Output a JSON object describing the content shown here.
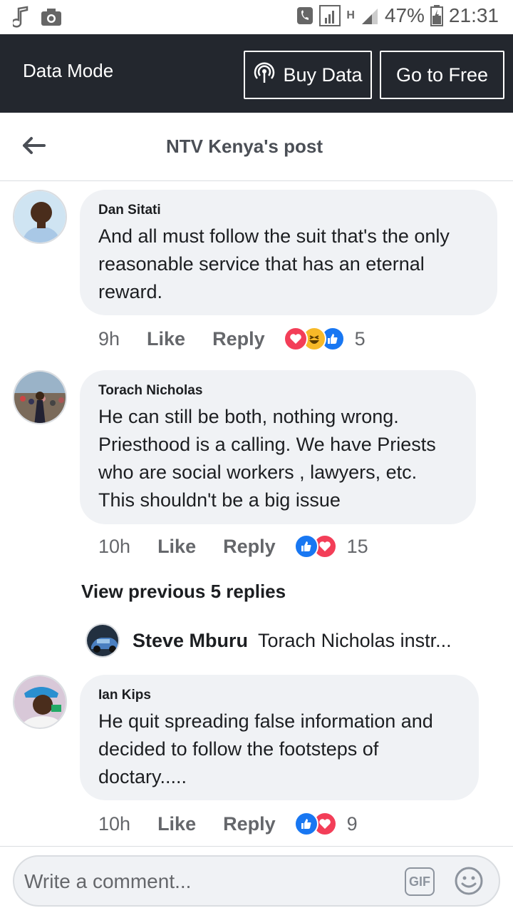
{
  "status_bar": {
    "battery": "47%",
    "time": "21:31",
    "network": "H"
  },
  "data_bar": {
    "title": "Data Mode",
    "buy_label": "Buy Data",
    "free_label": "Go to Free"
  },
  "header": {
    "title": "NTV Kenya's post"
  },
  "comments": [
    {
      "author": "Dan Sitati",
      "text": "And all must follow the suit that's the only reasonable service that has an eternal reward.",
      "time": "9h",
      "like": "Like",
      "reply": "Reply",
      "reactions": [
        "love",
        "haha",
        "like"
      ],
      "count": "5"
    },
    {
      "author": "Torach Nicholas",
      "text": "He can still be both, nothing wrong. Priesthood is a calling. We have Priests who are social workers , lawyers, etc. This shouldn't be a big issue",
      "time": "10h",
      "like": "Like",
      "reply": "Reply",
      "reactions": [
        "like",
        "love"
      ],
      "count": "15"
    },
    {
      "author": "Ian Kips",
      "text": "He quit spreading false information and decided to follow the footsteps of doctary.....",
      "time": "10h",
      "like": "Like",
      "reply": "Reply",
      "reactions": [
        "like",
        "love"
      ],
      "count": "9"
    }
  ],
  "replies": {
    "view_previous": "View previous 5 replies",
    "preview_author": "Steve Mburu",
    "preview_text": "Torach Nicholas instr..."
  },
  "composer": {
    "placeholder": "Write a comment...",
    "gif_label": "GIF"
  },
  "colors": {
    "data_bar_bg": "#23272e",
    "bubble_bg": "#f0f2f5",
    "like_blue": "#1877f2",
    "love_red": "#f33e58",
    "haha_yellow": "#f7b928"
  }
}
